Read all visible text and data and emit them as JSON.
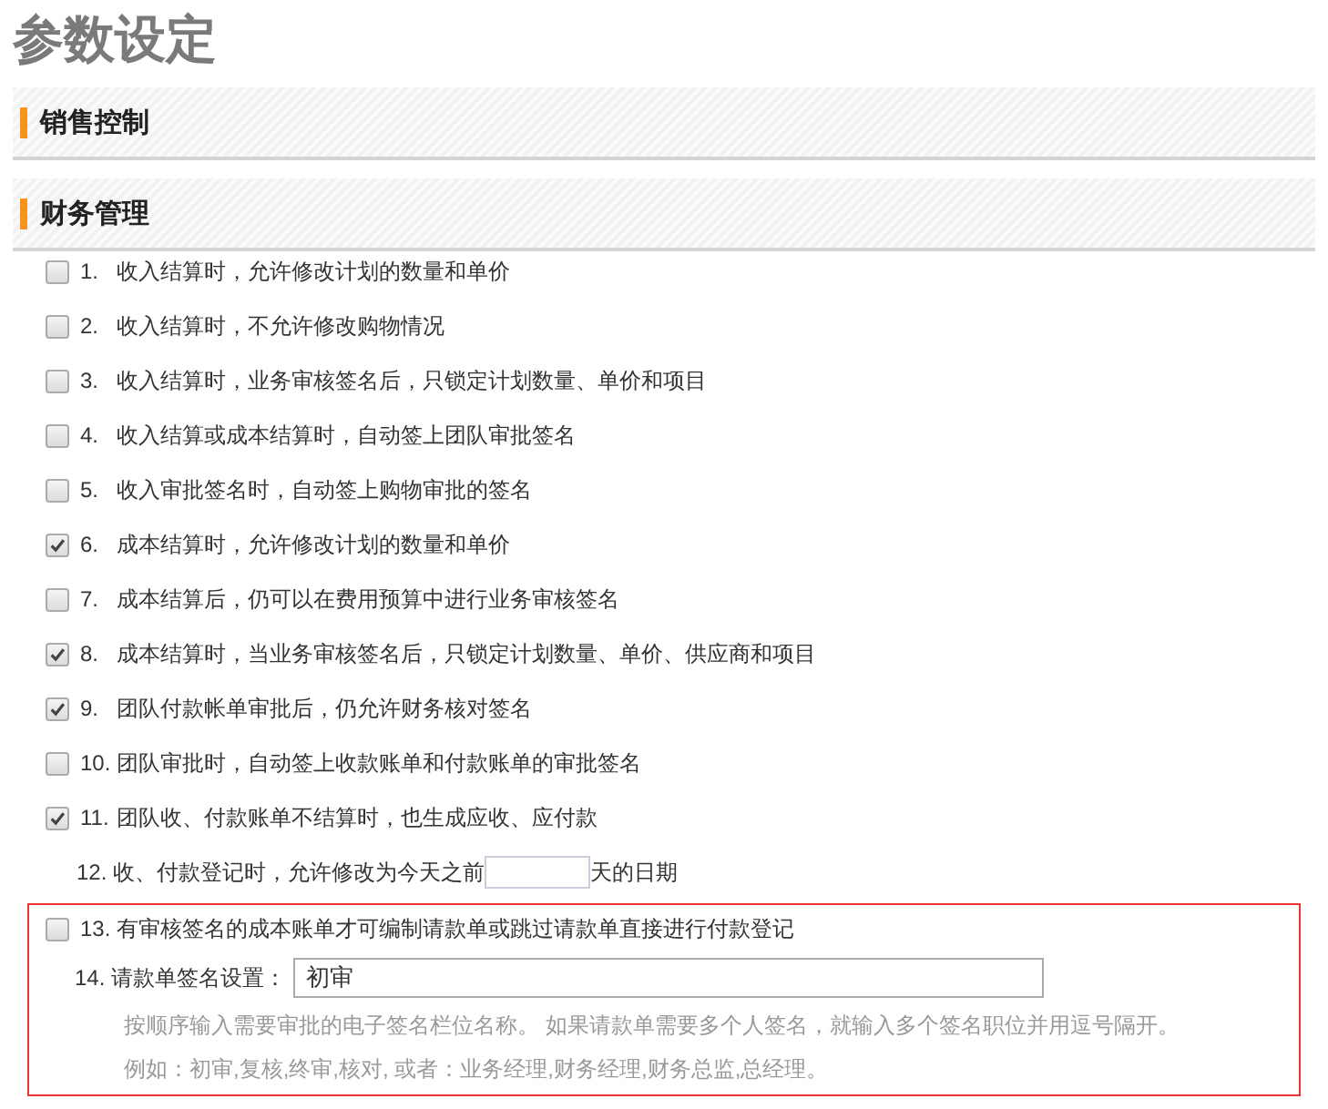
{
  "title": "参数设定",
  "sections": [
    {
      "title": "销售控制"
    },
    {
      "title": "财务管理",
      "options": [
        {
          "kind": "checkbox",
          "number": "1.",
          "label": "收入结算时，允许修改计划的数量和单价",
          "checked": false
        },
        {
          "kind": "checkbox",
          "number": "2.",
          "label": "收入结算时，不允许修改购物情况",
          "checked": false
        },
        {
          "kind": "checkbox",
          "number": "3.",
          "label": "收入结算时，业务审核签名后，只锁定计划数量、单价和项目",
          "checked": false
        },
        {
          "kind": "checkbox",
          "number": "4.",
          "label": "收入结算或成本结算时，自动签上团队审批签名",
          "checked": false
        },
        {
          "kind": "checkbox",
          "number": "5.",
          "label": "收入审批签名时，自动签上购物审批的签名",
          "checked": false
        },
        {
          "kind": "checkbox",
          "number": "6.",
          "label": "成本结算时，允许修改计划的数量和单价",
          "checked": true
        },
        {
          "kind": "checkbox",
          "number": "7.",
          "label": "成本结算后，仍可以在费用预算中进行业务审核签名",
          "checked": false
        },
        {
          "kind": "checkbox",
          "number": "8.",
          "label": "成本结算时，当业务审核签名后，只锁定计划数量、单价、供应商和项目",
          "checked": true
        },
        {
          "kind": "checkbox",
          "number": "9.",
          "label": "团队付款帐单审批后，仍允许财务核对签名",
          "checked": true
        },
        {
          "kind": "checkbox",
          "number": "10.",
          "label": "团队审批时，自动签上收款账单和付款账单的审批签名",
          "checked": false
        },
        {
          "kind": "checkbox",
          "number": "11.",
          "label": "团队收、付款账单不结算时，也生成应收、应付款",
          "checked": true
        },
        {
          "kind": "days",
          "number": "12.",
          "label": "收、付款登记时，允许修改为今天之前",
          "suffix": "天的日期"
        }
      ],
      "highlight_box": {
        "option": {
          "number": "13.",
          "label": "有审核签名的成本账单才可编制请款单或跳过请款单直接进行付款登记",
          "checked": false
        },
        "signature": {
          "number": "14.",
          "label": "请款单签名设置：",
          "value": "初审"
        },
        "hints": [
          "按顺序输入需要审批的电子签名栏位名称。 如果请款单需要多个人签名，就输入多个签名职位并用逗号隔开。",
          "例如：初审,复核,终审,核对, 或者：业务经理,财务经理,财务总监,总经理。"
        ]
      }
    }
  ]
}
